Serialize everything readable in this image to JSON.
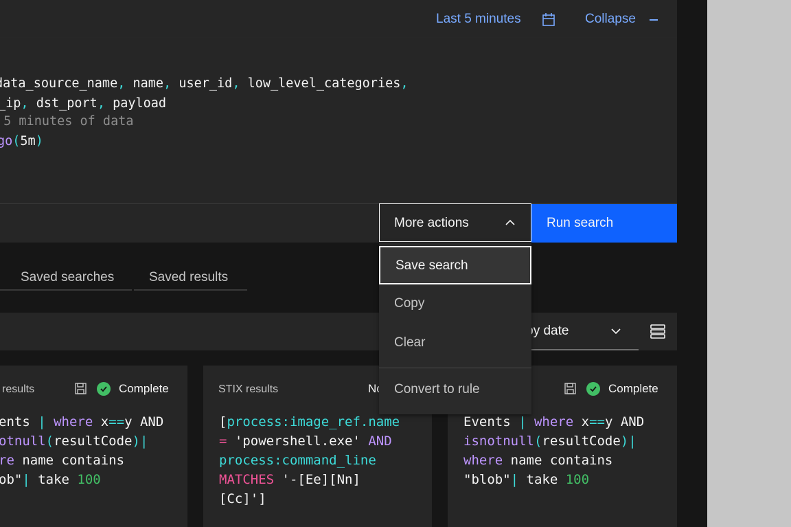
{
  "header": {
    "time_range": "Last 5 minutes",
    "calendar_icon": "calendar-icon",
    "collapse": "Collapse"
  },
  "editor": {
    "line1": [
      {
        "t": "data_source_name"
      },
      {
        "t": ", ",
        "p": 1
      },
      {
        "t": "name"
      },
      {
        "t": ", ",
        "p": 1
      },
      {
        "t": "user_id"
      },
      {
        "t": ", ",
        "p": 1
      },
      {
        "t": "low_level_categories"
      },
      {
        "t": ",",
        "p": 1
      }
    ],
    "line2": [
      {
        "t": "_ip"
      },
      {
        "t": ", ",
        "p": 1
      },
      {
        "t": "dst_port"
      },
      {
        "t": ", ",
        "p": 1
      },
      {
        "t": "payload"
      }
    ],
    "line3": " 5 minutes of data",
    "line4_fn": "go",
    "line4_open": "(",
    "line4_arg": "5m",
    "line4_close": ")"
  },
  "toolbar": {
    "more_actions": "More actions",
    "run_search": "Run search"
  },
  "menu": {
    "items": [
      "Save search",
      "Copy",
      "Clear",
      "Convert to rule"
    ]
  },
  "tabs": [
    "Saved searches",
    "Saved results"
  ],
  "sort": {
    "label": "Sort by date"
  },
  "cards": [
    {
      "title": "results",
      "status": "Complete",
      "lines": [
        "ents | where x==y AND",
        "otnull(resultCode)|",
        "re name contains",
        "ob\"| take 100"
      ]
    },
    {
      "title": "STIX results",
      "status": "No",
      "lines": [
        "[process:image_ref.name",
        "= 'powershell.exe' AND",
        "process:command_line",
        "MATCHES '-[Ee][Nn]",
        "[Cc]']"
      ]
    },
    {
      "title": "",
      "status": "Complete",
      "lines": [
        "Events | where x==y AND",
        "isnotnull(resultCode)|",
        "where name contains",
        "\"blob\"| take 100"
      ]
    }
  ],
  "colors": {
    "accent": "#0f62fe",
    "link": "#78a9ff",
    "success": "#42be65",
    "keyword": "#be95ff",
    "punct": "#3ddbd9",
    "operator": "#ee5396"
  }
}
